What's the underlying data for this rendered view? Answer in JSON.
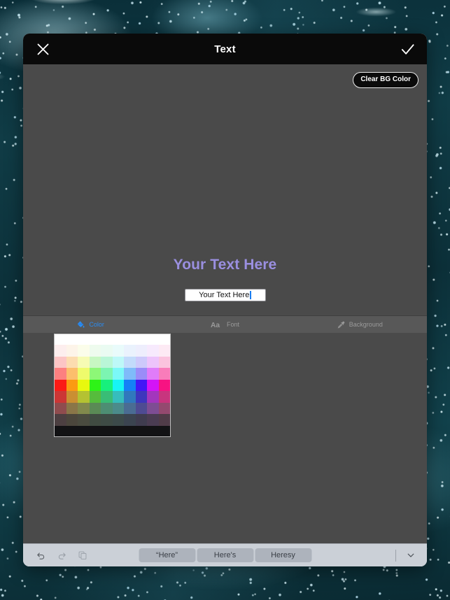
{
  "window": {
    "title": "Text"
  },
  "titlebar": {
    "close_icon": "close-icon",
    "done_icon": "checkmark-icon"
  },
  "canvas": {
    "clear_bg_label": "Clear BG Color",
    "preview_text": "Your Text Here",
    "preview_color": "#9a8fe0",
    "background_color": "#4a4a4a"
  },
  "text_field": {
    "value": "Your Text Here",
    "placeholder": "Your Text Here"
  },
  "tabs": [
    {
      "label": "Color",
      "icon": "paint-bucket-icon",
      "active": true
    },
    {
      "label": "Font",
      "icon": "aa-typography-icon",
      "active": false
    },
    {
      "label": "Background",
      "icon": "eyedropper-icon",
      "active": false
    }
  ],
  "tab_colors": {
    "active": "#2b8cf0",
    "inactive": "#9a9a9a"
  },
  "color_picker": {
    "columns": 10,
    "rows": [
      {
        "kind": "solid",
        "color": "#ffffff"
      },
      {
        "kind": "grid",
        "colors": [
          "#fdeeee",
          "#fdf4e9",
          "#fbfdea",
          "#eefbee",
          "#eafbf2",
          "#e9fbfb",
          "#eaf2fd",
          "#eeeefd",
          "#f7eafd",
          "#fdeaf4"
        ]
      },
      {
        "kind": "grid",
        "colors": [
          "#fcc5c5",
          "#fcdcb0",
          "#f6fbb4",
          "#c7f7c2",
          "#b9f6d7",
          "#bdf8f8",
          "#c2dbfb",
          "#cdc9fb",
          "#edc4fb",
          "#fbc3de"
        ]
      },
      {
        "kind": "grid",
        "colors": [
          "#fc8080",
          "#fcbe6c",
          "#eefb6c",
          "#8df777",
          "#7cf5b2",
          "#7bf8f8",
          "#7fbbf9",
          "#9a8cf8",
          "#e07cf9",
          "#f97cba"
        ]
      },
      {
        "kind": "grid",
        "colors": [
          "#fb1b16",
          "#fb9b12",
          "#e8f80e",
          "#2ef317",
          "#17f07c",
          "#17f4f4",
          "#1580f6",
          "#4216f6",
          "#d314f7",
          "#f71382"
        ]
      },
      {
        "kind": "grid",
        "colors": [
          "#cc3635",
          "#ca8f32",
          "#b4c232",
          "#56bc3c",
          "#39bd76",
          "#36bdbd",
          "#3078bd",
          "#3d36bd",
          "#a336bd",
          "#c8357e"
        ]
      },
      {
        "kind": "grid",
        "colors": [
          "#8f4c4e",
          "#8a7648",
          "#81894c",
          "#5a8a55",
          "#4d8d73",
          "#4b8b8b",
          "#4a6c93",
          "#4e4b92",
          "#7d4d93",
          "#94496f"
        ]
      },
      {
        "kind": "grid",
        "colors": [
          "#4c3f41",
          "#4b463c",
          "#4a4b3f",
          "#404b41",
          "#3e4b45",
          "#3c4a4a",
          "#3b4450",
          "#3f3c4f",
          "#4a3c52",
          "#503c48"
        ]
      },
      {
        "kind": "solid",
        "color": "#121214"
      }
    ]
  },
  "accessory_bar": {
    "undo_icon": "undo-arrow-icon",
    "redo_icon": "redo-arrow-icon",
    "paste_icon": "paste-icon",
    "dismiss_icon": "chevron-down-icon",
    "suggestions": [
      "“Here”",
      "Here's",
      "Heresy"
    ]
  }
}
